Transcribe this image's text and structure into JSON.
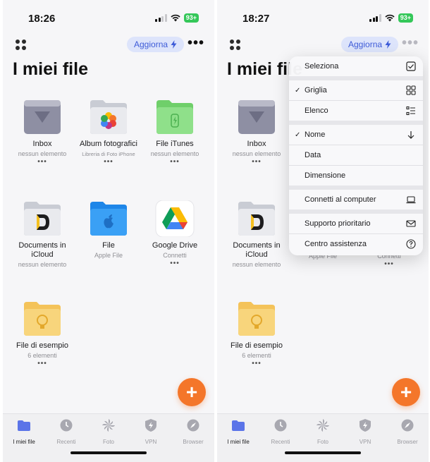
{
  "screens": [
    {
      "time": "18:26",
      "battery": "93+",
      "refresh_label": "Aggiorna",
      "more_label": "•••",
      "title": "I miei file"
    },
    {
      "time": "18:27",
      "battery": "93+",
      "refresh_label": "Aggiorna",
      "more_label": "•••",
      "title": "I miei file"
    }
  ],
  "tiles": [
    {
      "name": "Inbox",
      "sub": "nessun elemento",
      "icon": "inbox-folder-icon"
    },
    {
      "name": "Album fotografici",
      "sub": "Libreria di Foto iPhone",
      "icon": "photos-folder-icon"
    },
    {
      "name": "File iTunes",
      "sub": "nessun elemento",
      "icon": "itunes-folder-icon"
    },
    {
      "name": "Documents in iCloud",
      "sub": "nessun elemento",
      "icon": "icloud-documents-folder-icon"
    },
    {
      "name": "File",
      "sub": "Apple File",
      "icon": "apple-files-folder-icon"
    },
    {
      "name": "Google Drive",
      "sub": "Connetti",
      "icon": "google-drive-icon"
    },
    {
      "name": "File di esempio",
      "sub": "6 elementi",
      "icon": "sample-files-folder-icon"
    }
  ],
  "tile_more": "•••",
  "fab_label": "+",
  "tabs": [
    {
      "label": "I miei file",
      "icon": "folder-icon"
    },
    {
      "label": "Recenti",
      "icon": "clock-icon"
    },
    {
      "label": "Foto",
      "icon": "pinwheel-icon"
    },
    {
      "label": "VPN",
      "icon": "shield-bolt-icon"
    },
    {
      "label": "Browser",
      "icon": "compass-icon"
    }
  ],
  "menu": {
    "select": {
      "label": "Seleziona",
      "icon": "checkbox-icon"
    },
    "grid": {
      "label": "Griglia",
      "checked": "✓",
      "icon": "grid-icon"
    },
    "list": {
      "label": "Elenco",
      "icon": "list-icon"
    },
    "name": {
      "label": "Nome",
      "checked": "✓",
      "icon": "arrow-down-icon"
    },
    "date": {
      "label": "Data"
    },
    "size": {
      "label": "Dimensione"
    },
    "connect": {
      "label": "Connetti al computer",
      "icon": "laptop-icon"
    },
    "support": {
      "label": "Supporto prioritario",
      "icon": "envelope-icon"
    },
    "help": {
      "label": "Centro assistenza",
      "icon": "question-circle-icon"
    }
  },
  "colors": {
    "accent": "#3d5bd8",
    "fab": "#f4762a",
    "battery": "#34c759"
  }
}
